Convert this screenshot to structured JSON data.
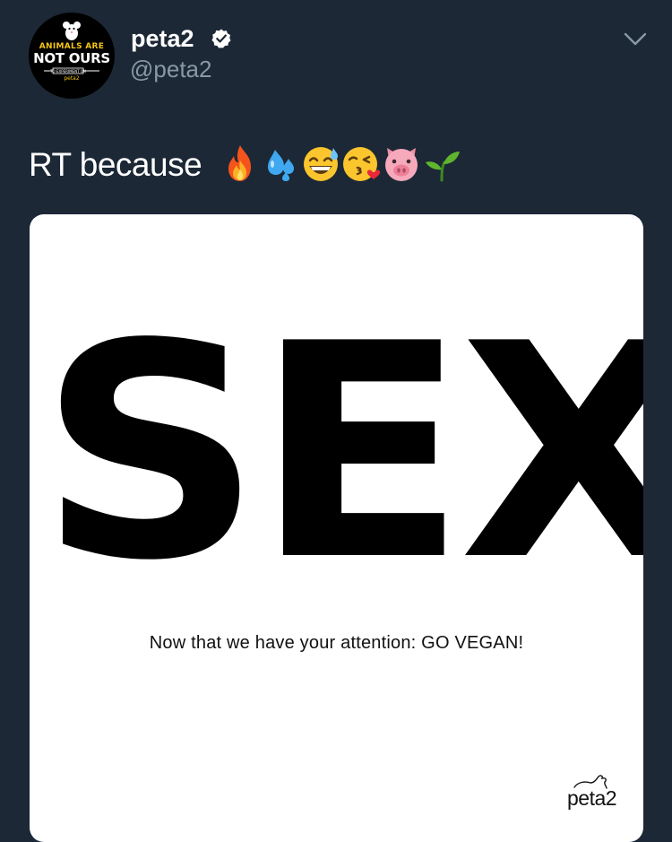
{
  "user": {
    "name": "peta2",
    "handle": "@peta2",
    "verified": true,
    "avatar": {
      "line1": "ANIMALS ARE",
      "line2": "NOT OURS",
      "line3": "TO EXPERIMENT ON",
      "brand": "peta2"
    }
  },
  "tweet": {
    "text": "RT because",
    "emojis": [
      "fire",
      "sweat-droplets",
      "grinning-sweat",
      "kissing-heart",
      "pig",
      "seedling"
    ]
  },
  "card": {
    "headline": "SEX",
    "caption": "Now that we have your attention: GO VEGAN!",
    "logo_text": "peta2"
  },
  "colors": {
    "background": "#1c2836",
    "secondary_text": "#8899a6",
    "accent_yellow": "#f3c514"
  }
}
